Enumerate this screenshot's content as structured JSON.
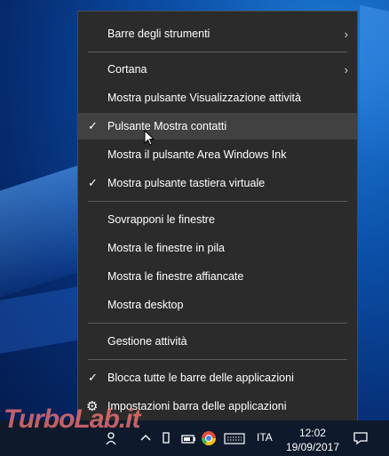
{
  "menu": {
    "items": [
      {
        "label": "Barre degli strumenti",
        "checked": false,
        "submenu": true
      },
      {
        "label": "Cortana",
        "checked": false,
        "submenu": true
      },
      {
        "label": "Mostra pulsante Visualizzazione attività",
        "checked": false
      },
      {
        "label": "Pulsante Mostra contatti",
        "checked": true
      },
      {
        "label": "Mostra il pulsante Area Windows Ink",
        "checked": false
      },
      {
        "label": "Mostra pulsante tastiera virtuale",
        "checked": true
      },
      {
        "label": "Sovrapponi le finestre"
      },
      {
        "label": "Mostra le finestre in pila"
      },
      {
        "label": "Mostra le finestre affiancate"
      },
      {
        "label": "Mostra desktop"
      },
      {
        "label": "Gestione attività"
      },
      {
        "label": "Blocca tutte le barre delle applicazioni",
        "checked": true
      },
      {
        "label": "Impostazioni barra delle applicazioni",
        "icon": "gear-icon"
      }
    ],
    "check_glyph": "✓",
    "arrow_glyph": "›",
    "gear_glyph": "⚙"
  },
  "taskbar": {
    "language": "ITA",
    "time": "12:02",
    "date": "19/09/2017"
  },
  "watermark": "TurboLab.it",
  "colors": {
    "menu_bg": "#2b2b2b",
    "hover_bg": "#414141",
    "taskbar_bg": "#0e1a2c"
  }
}
